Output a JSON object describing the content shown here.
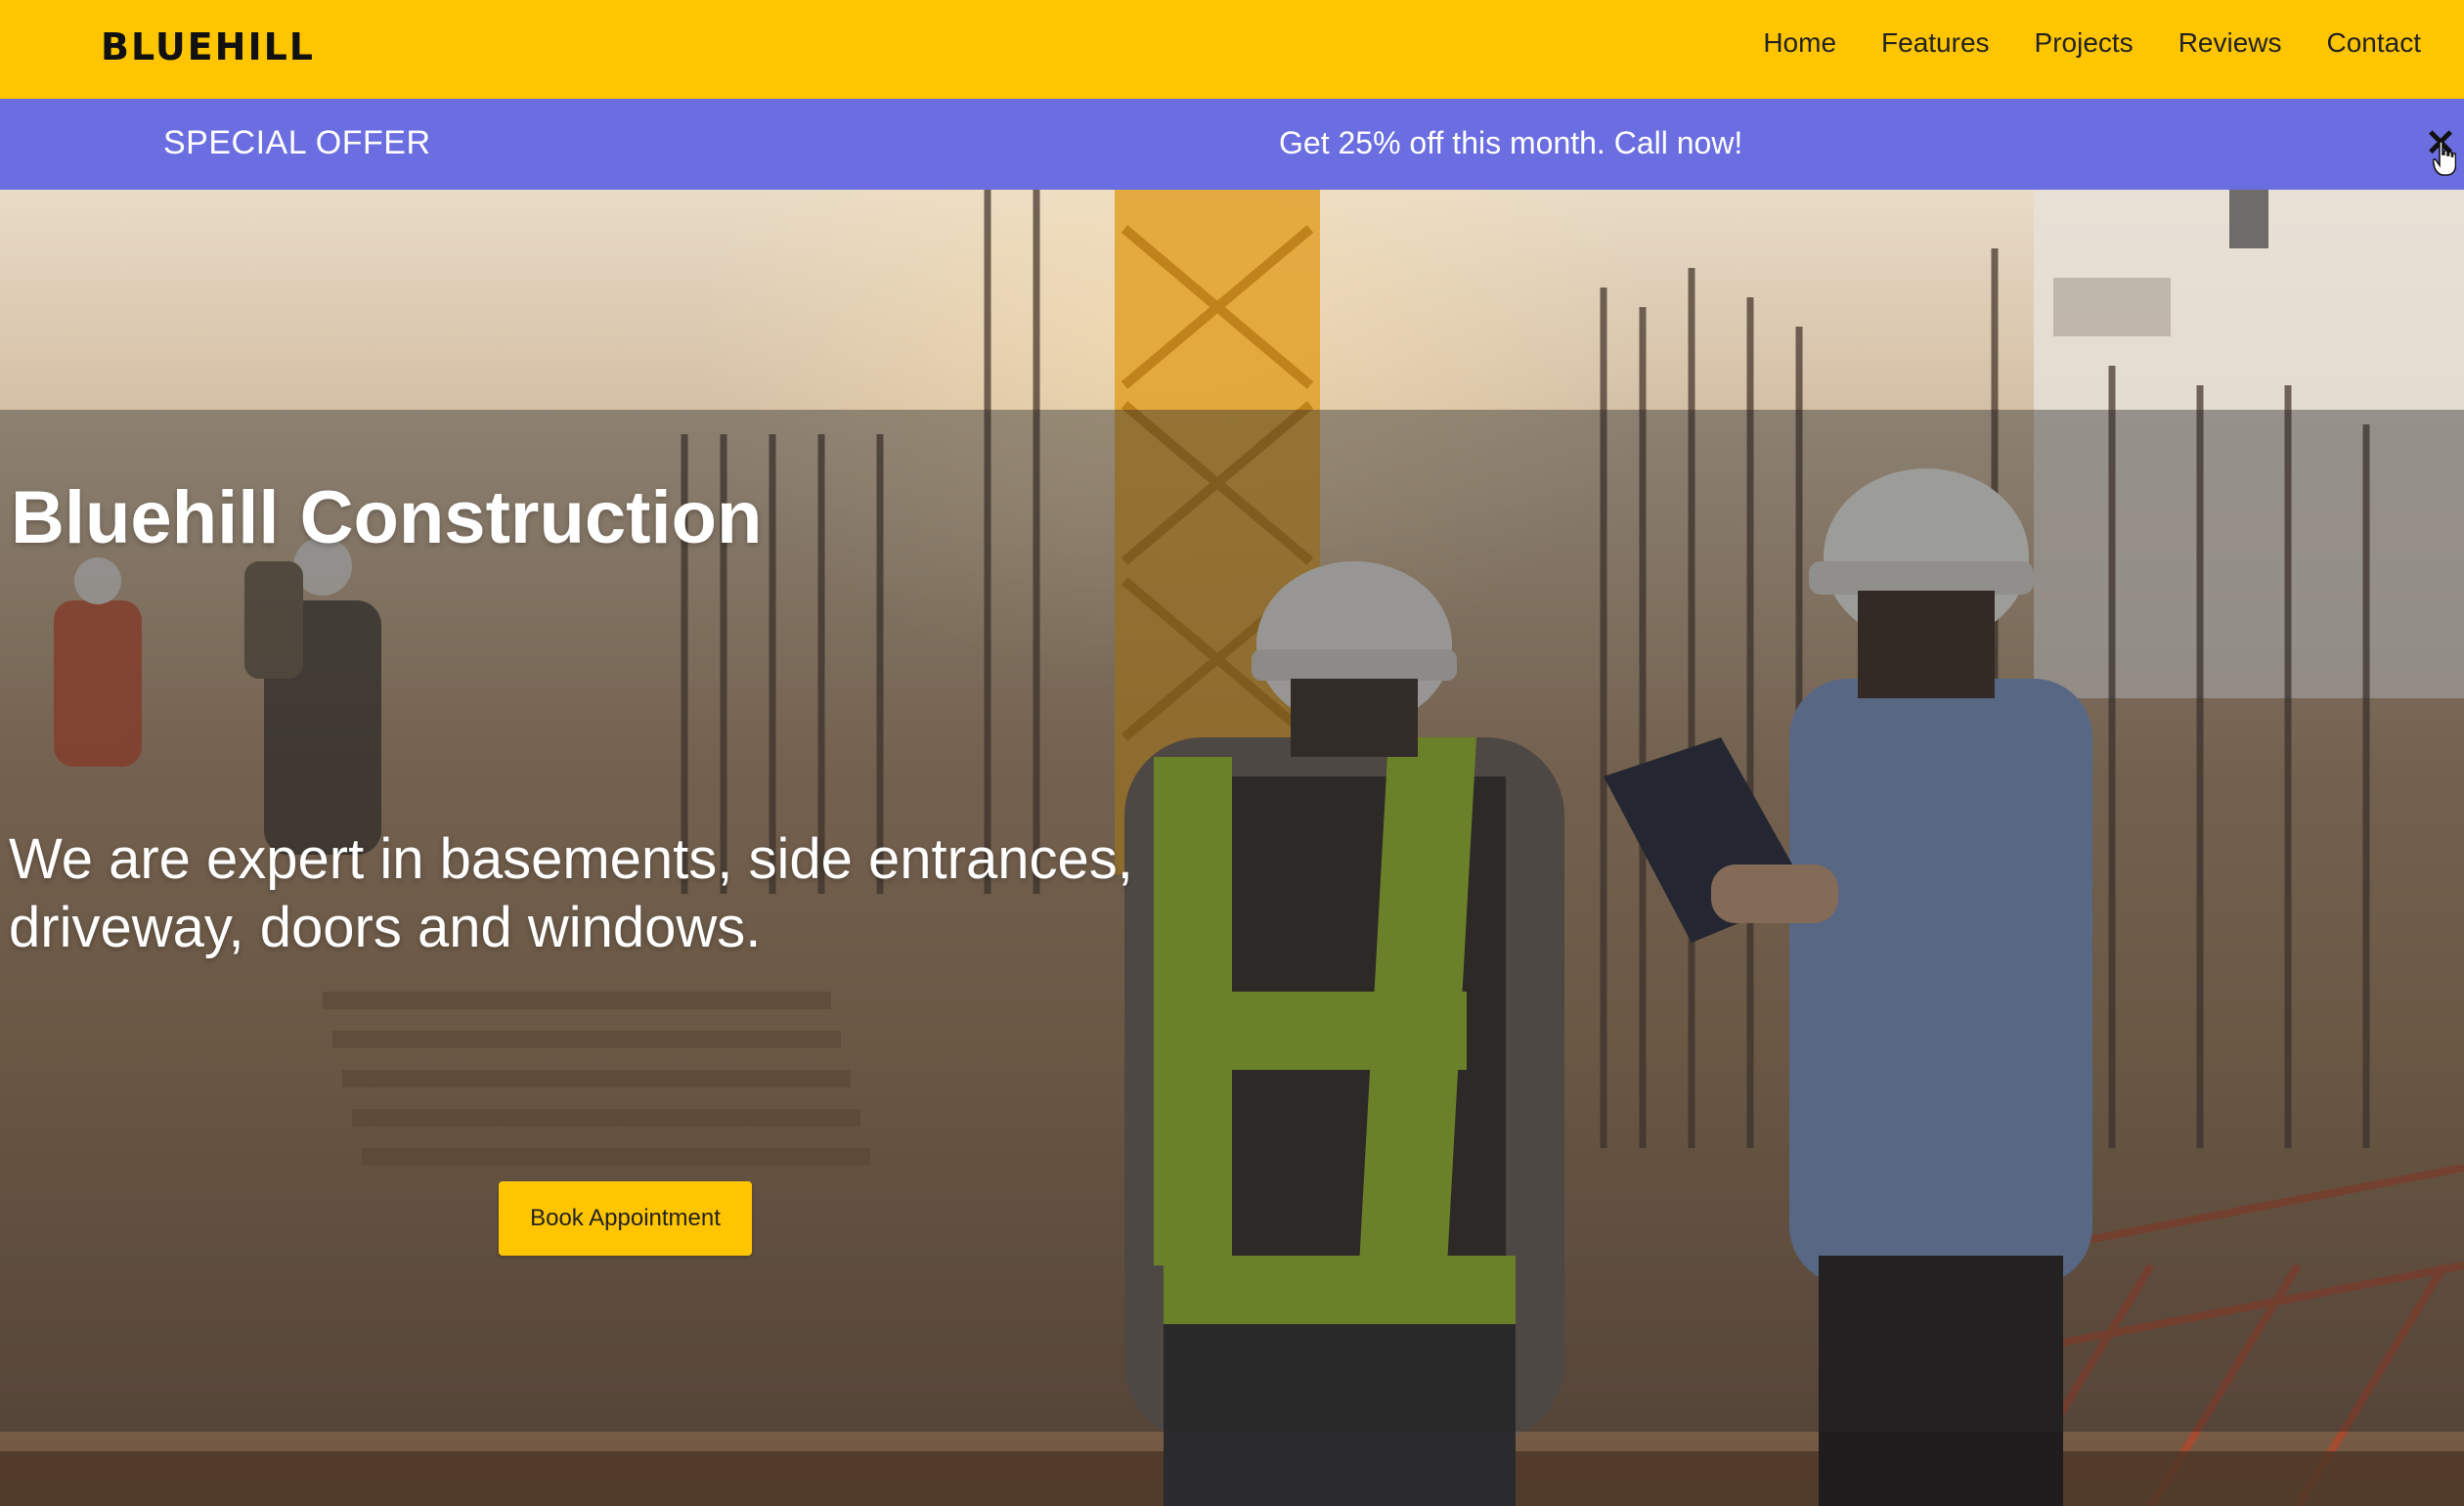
{
  "header": {
    "logo": "BLUEHILL",
    "nav": [
      "Home",
      "Features",
      "Projects",
      "Reviews",
      "Contact"
    ]
  },
  "offer": {
    "label": "SPECIAL OFFER",
    "text": "Get 25% off this month. Call now!",
    "close": "✕"
  },
  "hero": {
    "title": "Bluehill Construction",
    "subtitle": "We are expert in basements, side entrances, driveway, doors and windows.",
    "cta": "Book Appointment"
  },
  "colors": {
    "brand_yellow": "#ffc500",
    "offer_bg": "#6b6ee0",
    "text_dark": "#111111",
    "text_light": "#ffffff"
  },
  "icons": {
    "close": "close-icon",
    "cursor": "hand-cursor-icon"
  }
}
